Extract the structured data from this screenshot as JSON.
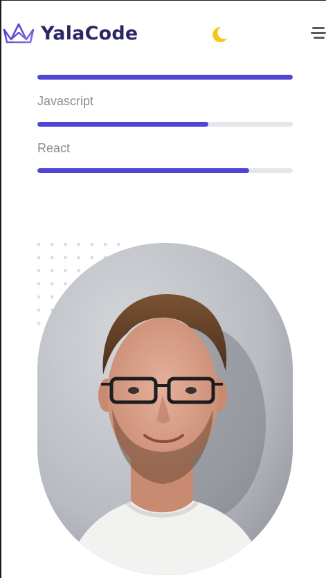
{
  "header": {
    "brand_name": "YalaCode",
    "logo_icon": "crown-icon",
    "theme_icon": "moon-icon",
    "menu_icon": "hamburger-icon"
  },
  "skills": [
    {
      "label": "",
      "percent": 100
    },
    {
      "label": "Javascript",
      "percent": 67
    },
    {
      "label": "React",
      "percent": 83
    }
  ],
  "colors": {
    "accent": "#4e44d8",
    "brand_text": "#2a2766",
    "track": "#e6e7ec",
    "moon": "#f5c518"
  },
  "profile_photo": {
    "subject": "portrait-photo"
  }
}
